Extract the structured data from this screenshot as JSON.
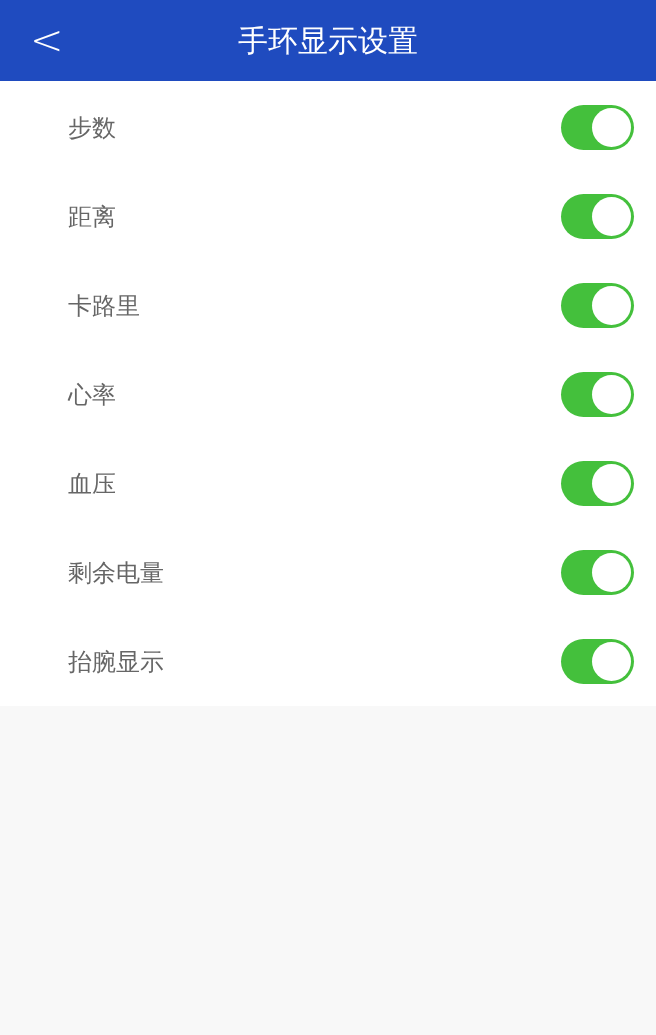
{
  "header": {
    "back": "<",
    "title": "手环显示设置"
  },
  "settings": [
    {
      "label": "步数",
      "on": true
    },
    {
      "label": "距离",
      "on": true
    },
    {
      "label": "卡路里",
      "on": true
    },
    {
      "label": "心率",
      "on": true
    },
    {
      "label": "血压",
      "on": true
    },
    {
      "label": "剩余电量",
      "on": true
    },
    {
      "label": "抬腕显示",
      "on": true
    }
  ]
}
